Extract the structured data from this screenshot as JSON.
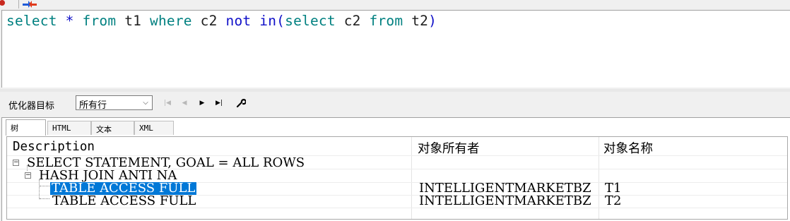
{
  "sql": {
    "tokens": [
      {
        "text": "select",
        "kind": "kw"
      },
      {
        "text": " ",
        "kind": "id"
      },
      {
        "text": "*",
        "kind": "op"
      },
      {
        "text": " ",
        "kind": "id"
      },
      {
        "text": "from",
        "kind": "kw"
      },
      {
        "text": " t1 ",
        "kind": "id"
      },
      {
        "text": "where",
        "kind": "kw"
      },
      {
        "text": " c2 ",
        "kind": "id"
      },
      {
        "text": "not",
        "kind": "kw2"
      },
      {
        "text": " ",
        "kind": "id"
      },
      {
        "text": "in",
        "kind": "kw2"
      },
      {
        "text": "(",
        "kind": "op"
      },
      {
        "text": "select",
        "kind": "kw"
      },
      {
        "text": " c2 ",
        "kind": "id"
      },
      {
        "text": "from",
        "kind": "kw"
      },
      {
        "text": " t2",
        "kind": "id"
      },
      {
        "text": ")",
        "kind": "op"
      }
    ]
  },
  "optimizer": {
    "label": "优化器目标",
    "selected": "所有行"
  },
  "tabs": {
    "tree": "树",
    "html": "HTML",
    "text": "文本",
    "xml": "XML"
  },
  "plan": {
    "headers": {
      "description": "Description",
      "owner": "对象所有者",
      "name": "对象名称"
    },
    "rows": [
      {
        "description": "SELECT STATEMENT, GOAL = ALL ROWS",
        "owner": "",
        "name": ""
      },
      {
        "description": "HASH JOIN ANTI NA",
        "owner": "",
        "name": ""
      },
      {
        "description": "TABLE ACCESS FULL",
        "owner": "INTELLIGENTMARKETBZ",
        "name": "T1"
      },
      {
        "description": "TABLE ACCESS FULL",
        "owner": "INTELLIGENTMARKETBZ",
        "name": "T2"
      }
    ]
  },
  "colors": {
    "keyword": "#008080",
    "keyword2": "#1010c8",
    "selection": "#0078d7"
  }
}
